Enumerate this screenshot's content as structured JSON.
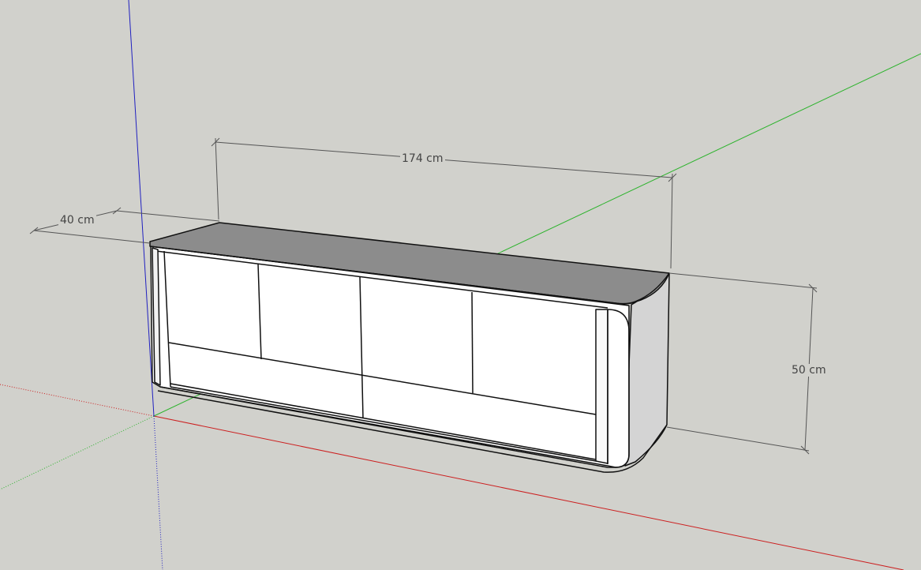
{
  "dimensions": {
    "width_label": "174 cm",
    "depth_label": "40 cm",
    "height_label": "50 cm"
  },
  "colors": {
    "background": "#d1d1cc",
    "x_axis": "#cc1f1f",
    "y_axis": "#2db32d",
    "z_axis": "#2020c0",
    "top_face": "#8c8c8c",
    "front_face": "#ffffff",
    "side_face": "#d4d4d4",
    "edge": "#111111",
    "dimension_line": "#555555"
  }
}
